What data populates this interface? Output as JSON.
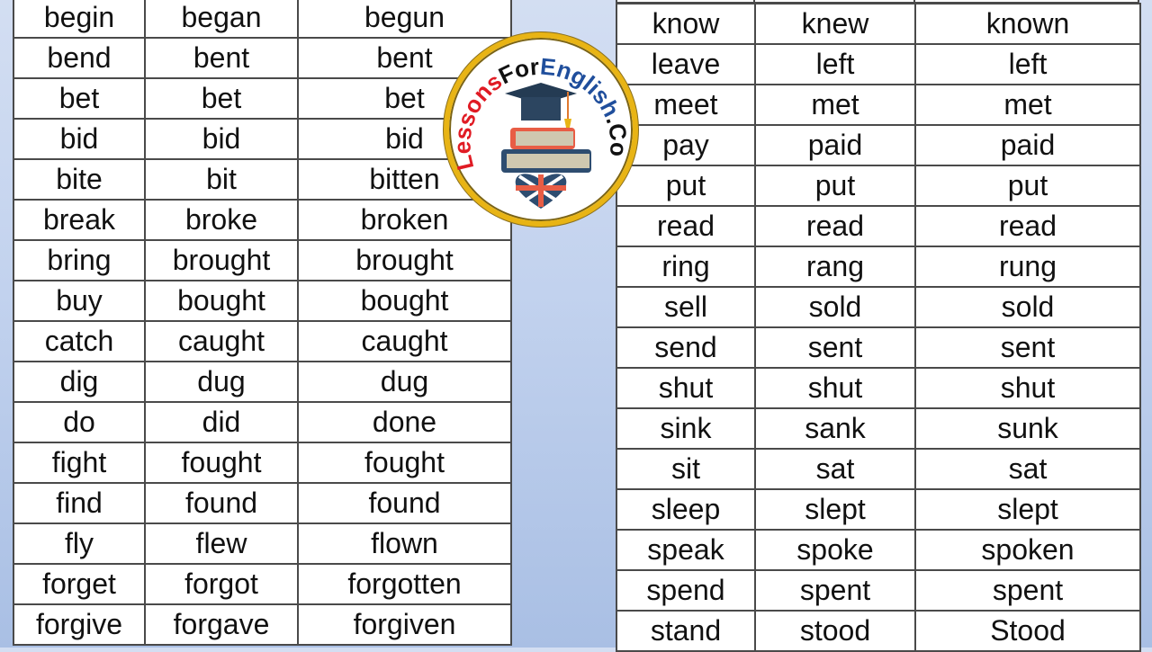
{
  "logo": {
    "text_part1": "Lessons",
    "text_part2": "For",
    "text_part3": "English",
    "text_part4": ".Com",
    "icons": [
      "graduation-cap-icon",
      "books-icon",
      "uk-flag-heart-icon"
    ],
    "colors": {
      "lessons": "#e01b24",
      "for": "#111111",
      "english": "#1f4e9c",
      "com": "#111111",
      "ring": "#e8b415"
    }
  },
  "left_table": {
    "rows": [
      [
        "begin",
        "began",
        "begun"
      ],
      [
        "bend",
        "bent",
        "bent"
      ],
      [
        "bet",
        "bet",
        "bet"
      ],
      [
        "bid",
        "bid",
        "bid"
      ],
      [
        "bite",
        "bit",
        "bitten"
      ],
      [
        "break",
        "broke",
        "broken"
      ],
      [
        "bring",
        "brought",
        "brought"
      ],
      [
        "buy",
        "bought",
        "bought"
      ],
      [
        "catch",
        "caught",
        "caught"
      ],
      [
        "dig",
        "dug",
        "dug"
      ],
      [
        "do",
        "did",
        "done"
      ],
      [
        "fight",
        "fought",
        "fought"
      ],
      [
        "find",
        "found",
        "found"
      ],
      [
        "fly",
        "flew",
        "flown"
      ],
      [
        "forget",
        "forgot",
        "forgotten"
      ],
      [
        "forgive",
        "forgave",
        "forgiven"
      ]
    ]
  },
  "right_table": {
    "rows": [
      [
        "know",
        "knew",
        "known"
      ],
      [
        "leave",
        "left",
        "left"
      ],
      [
        "meet",
        "met",
        "met"
      ],
      [
        "pay",
        "paid",
        "paid"
      ],
      [
        "put",
        "put",
        "put"
      ],
      [
        "read",
        "read",
        "read"
      ],
      [
        "ring",
        "rang",
        "rung"
      ],
      [
        "sell",
        "sold",
        "sold"
      ],
      [
        "send",
        "sent",
        "sent"
      ],
      [
        "shut",
        "shut",
        "shut"
      ],
      [
        "sink",
        "sank",
        "sunk"
      ],
      [
        "sit",
        "sat",
        "sat"
      ],
      [
        "sleep",
        "slept",
        "slept"
      ],
      [
        "speak",
        "spoke",
        "spoken"
      ],
      [
        "spend",
        "spent",
        "spent"
      ],
      [
        "stand",
        "stood",
        "Stood"
      ]
    ]
  }
}
